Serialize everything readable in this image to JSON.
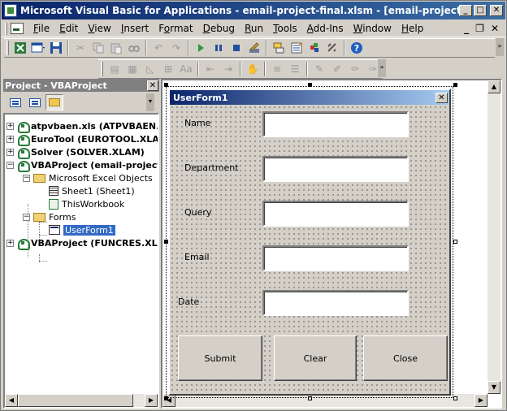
{
  "window": {
    "title": "Microsoft Visual Basic for Applications - email-project-final.xlsm - [email-project-final.xlsm - Use...",
    "controls": {
      "minimize": "_",
      "maximize": "□",
      "close": "✕"
    }
  },
  "menubar": {
    "items": [
      {
        "label": "File",
        "key": "F"
      },
      {
        "label": "Edit",
        "key": "E"
      },
      {
        "label": "View",
        "key": "V"
      },
      {
        "label": "Insert",
        "key": "I"
      },
      {
        "label": "Format",
        "key": "o"
      },
      {
        "label": "Debug",
        "key": "D"
      },
      {
        "label": "Run",
        "key": "R"
      },
      {
        "label": "Tools",
        "key": "T"
      },
      {
        "label": "Add-Ins",
        "key": "A"
      },
      {
        "label": "Window",
        "key": "W"
      },
      {
        "label": "Help",
        "key": "H"
      }
    ],
    "doc_controls": {
      "minimize": "_",
      "restore": "❐",
      "close": "✕"
    }
  },
  "toolbar_standard": [
    "excel-icon",
    "insert-userform-icon",
    "save-icon",
    "cut-icon",
    "copy-icon",
    "paste-icon",
    "find-icon",
    "undo-icon",
    "redo-icon",
    "run-icon",
    "break-icon",
    "reset-icon",
    "design-mode-icon",
    "project-explorer-icon",
    "properties-icon",
    "object-browser-icon",
    "toolbox-icon",
    "help-icon"
  ],
  "toolbar_edit": [
    "list-properties-icon",
    "list-constants-icon",
    "quick-info-icon",
    "parameter-info-icon",
    "complete-word-icon",
    "outdent-icon",
    "indent-icon",
    "toggle-breakpoint-icon",
    "comment-block-icon",
    "uncomment-block-icon",
    "toggle-bookmark-icon",
    "next-bookmark-icon",
    "previous-bookmark-icon",
    "clear-bookmarks-icon"
  ],
  "project_panel": {
    "title": "Project - VBAProject",
    "close": "✕",
    "tree": [
      {
        "label": "atpvbaen.xls (ATPVBAEN.X",
        "expander": "+"
      },
      {
        "label": "EuroTool (EUROTOOL.XLAM",
        "expander": "+"
      },
      {
        "label": "Solver (SOLVER.XLAM)",
        "expander": "+"
      },
      {
        "label": "VBAProject (email-project",
        "expander": "−"
      },
      {
        "label": "Microsoft Excel Objects",
        "expander": "−"
      },
      {
        "label": "Sheet1 (Sheet1)"
      },
      {
        "label": "ThisWorkbook"
      },
      {
        "label": "Forms",
        "expander": "−"
      },
      {
        "label": "UserForm1",
        "selected": true
      },
      {
        "label": "VBAProject (FUNCRES.XLAN",
        "expander": "+"
      }
    ]
  },
  "userform": {
    "title": "UserForm1",
    "close": "✕",
    "fields": [
      {
        "label": "Name",
        "value": ""
      },
      {
        "label": "Department",
        "value": ""
      },
      {
        "label": "Query",
        "value": ""
      },
      {
        "label": "Email",
        "value": ""
      },
      {
        "label": "Date",
        "value": ""
      }
    ],
    "buttons": [
      {
        "label": "Submit"
      },
      {
        "label": "Clear"
      },
      {
        "label": "Close"
      }
    ]
  }
}
